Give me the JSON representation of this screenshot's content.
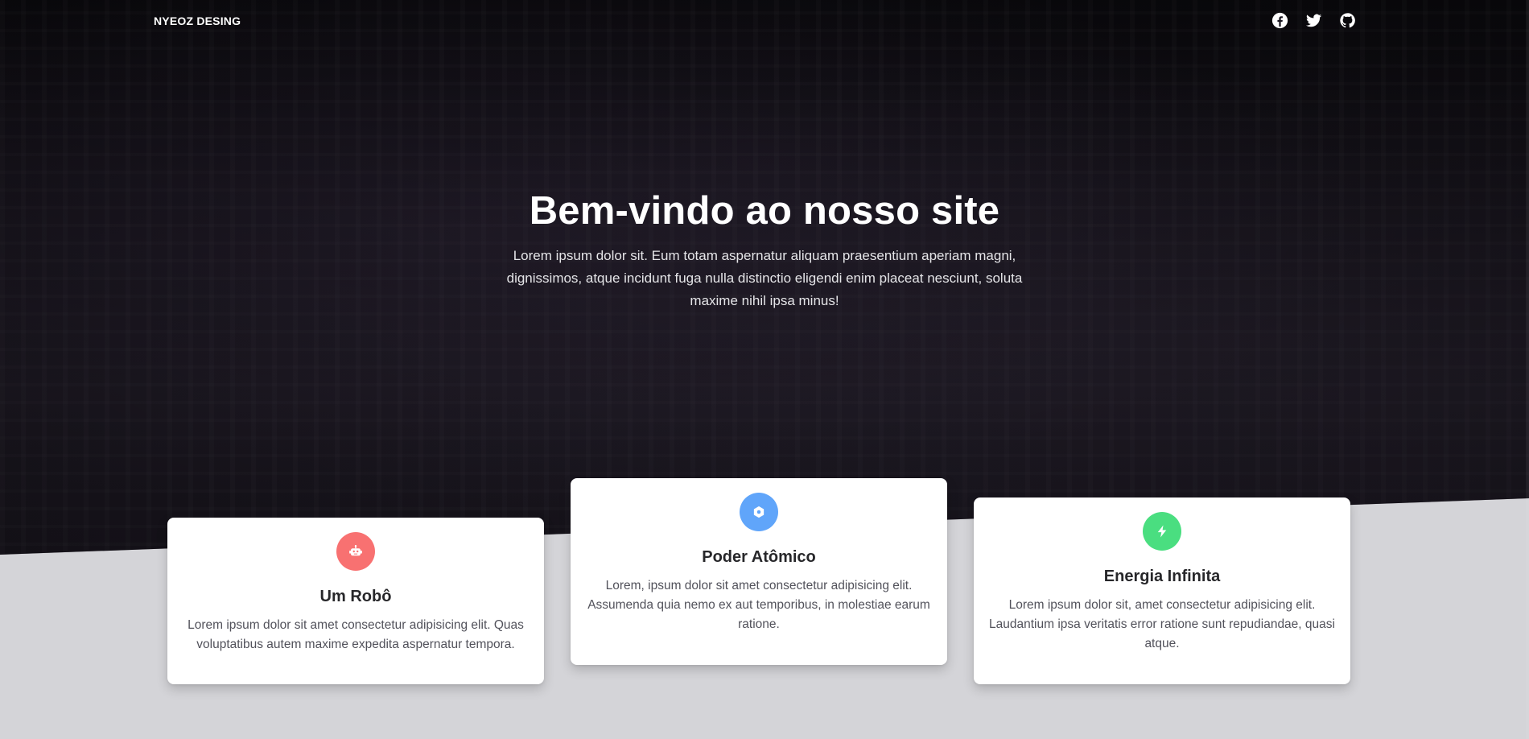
{
  "header": {
    "brand": "NYEOZ DESING",
    "social": [
      {
        "icon": "facebook-icon"
      },
      {
        "icon": "twitter-icon"
      },
      {
        "icon": "github-icon"
      }
    ]
  },
  "hero": {
    "title": "Bem-vindo ao nosso site",
    "text": "Lorem ipsum dolor sit. Eum totam aspernatur aliquam praesentium aperiam magni, dignissimos, atque incidunt fuga nulla distinctio eligendi enim placeat nesciunt, soluta maxime nihil ipsa minus!"
  },
  "cards": [
    {
      "icon": "robot-icon",
      "color": "#f87171",
      "title": "Um Robô",
      "text": "Lorem ipsum dolor sit amet consectetur adipisicing elit. Quas voluptatibus autem maxime expedita aspernatur tempora."
    },
    {
      "icon": "atom-icon",
      "color": "#60a5fa",
      "title": "Poder Atômico",
      "text": "Lorem, ipsum dolor sit amet consectetur adipisicing elit. Assumenda quia nemo ex aut temporibus, in molestiae earum ratione."
    },
    {
      "icon": "bolt-icon",
      "color": "#4ade80",
      "title": "Energia Infinita",
      "text": "Lorem ipsum dolor sit, amet consectetur adipisicing elit. Laudantium ipsa veritatis error ratione sunt repudiandae, quasi atque."
    }
  ]
}
